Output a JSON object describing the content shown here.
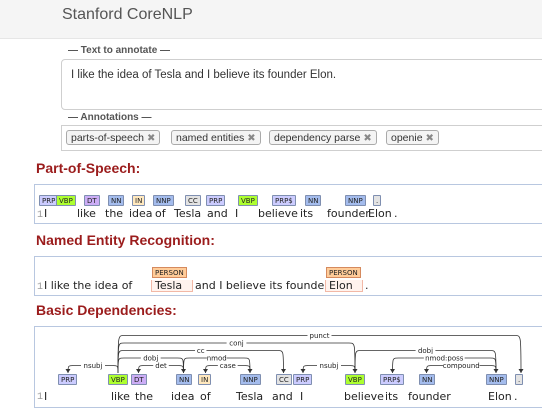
{
  "app": {
    "title": "Stanford CoreNLP"
  },
  "input": {
    "label": "— Text to annotate —",
    "value": "I like the idea of Tesla and I believe its founder Elon."
  },
  "annotations": {
    "label": "— Annotations —",
    "chips": [
      {
        "label": "parts-of-speech"
      },
      {
        "label": "named entities"
      },
      {
        "label": "dependency parse"
      },
      {
        "label": "openie"
      }
    ],
    "remove_glyph": "✖"
  },
  "sections": {
    "pos_title": "Part-of-Speech:",
    "ner_title": "Named Entity Recognition:",
    "dep_title": "Basic Dependencies:"
  },
  "colors": {
    "title_red": "#9b1c1c",
    "PRP": "#ccccff",
    "VBP": "#adff2f",
    "DT": "#ccadf6",
    "NN": "#a4bced",
    "IN": "#ffe8be",
    "NNP": "#a4bced",
    "CC": "#e3e3e3",
    "PRP$": "#ccccff",
    ".": "#e3e3e3",
    "PERSON": "#ffcc99"
  },
  "pos": {
    "line": "1",
    "tokens": [
      {
        "w": "I",
        "t": "PRP"
      },
      {
        "w": "like",
        "t": "VBP"
      },
      {
        "w": "the",
        "t": "DT"
      },
      {
        "w": "idea",
        "t": "NN"
      },
      {
        "w": "of",
        "t": "IN"
      },
      {
        "w": "Tesla",
        "t": "NNP"
      },
      {
        "w": "and",
        "t": "CC"
      },
      {
        "w": "I",
        "t": "PRP"
      },
      {
        "w": "believe",
        "t": "VBP"
      },
      {
        "w": "its",
        "t": "PRP$"
      },
      {
        "w": "founder",
        "t": "NN"
      },
      {
        "w": "Elon",
        "t": "NNP"
      },
      {
        "w": ".",
        "t": "."
      }
    ]
  },
  "ner": {
    "line": "1",
    "text_before": "I like the idea of",
    "ent1": {
      "w": "Tesla",
      "t": "PERSON"
    },
    "text_middle": "and I believe its founder",
    "ent2": {
      "w": "Elon",
      "t": "PERSON"
    },
    "text_after": "."
  },
  "dep": {
    "line": "1",
    "tokens": [
      {
        "w": "I",
        "t": "PRP"
      },
      {
        "w": "like",
        "t": "VBP"
      },
      {
        "w": "the",
        "t": "DT"
      },
      {
        "w": "idea",
        "t": "NN"
      },
      {
        "w": "of",
        "t": "IN"
      },
      {
        "w": "Tesla",
        "t": "NNP"
      },
      {
        "w": "and",
        "t": "CC"
      },
      {
        "w": "I",
        "t": "PRP"
      },
      {
        "w": "believe",
        "t": "VBP"
      },
      {
        "w": "its",
        "t": "PRP$"
      },
      {
        "w": "founder",
        "t": "NN"
      },
      {
        "w": "Elon",
        "t": "NNP"
      },
      {
        "w": ".",
        "t": "."
      }
    ],
    "arcs": [
      {
        "from": 1,
        "to": 0,
        "label": "nsubj"
      },
      {
        "from": 3,
        "to": 2,
        "label": "det"
      },
      {
        "from": 1,
        "to": 3,
        "label": "dobj"
      },
      {
        "from": 5,
        "to": 4,
        "label": "case"
      },
      {
        "from": 3,
        "to": 5,
        "label": "nmod"
      },
      {
        "from": 1,
        "to": 6,
        "label": "cc"
      },
      {
        "from": 1,
        "to": 8,
        "label": "conj"
      },
      {
        "from": 1,
        "to": 12,
        "label": "punct"
      },
      {
        "from": 8,
        "to": 7,
        "label": "nsubj"
      },
      {
        "from": 8,
        "to": 11,
        "label": "dobj"
      },
      {
        "from": 11,
        "to": 9,
        "label": "nmod:poss"
      },
      {
        "from": 11,
        "to": 10,
        "label": "compound"
      }
    ]
  }
}
